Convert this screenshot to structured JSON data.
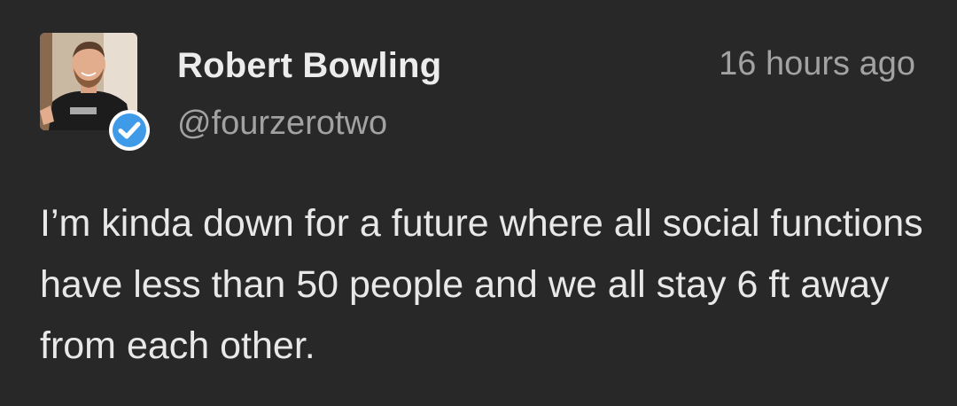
{
  "tweet": {
    "author_name": "Robert Bowling",
    "handle": "@fourzerotwo",
    "timestamp": "16 hours ago",
    "text": "I’m kinda down for a future where all social functions have less than 50 people and we all stay 6 ft away from each other.",
    "avatar": "avatar-photo",
    "verified_badge": "verified-check-icon"
  },
  "colors": {
    "background": "#282828",
    "name": "#ececec",
    "secondary_text": "#a2a2a2",
    "body_text": "#e8e8e8",
    "verified": "#3f9ae8"
  }
}
